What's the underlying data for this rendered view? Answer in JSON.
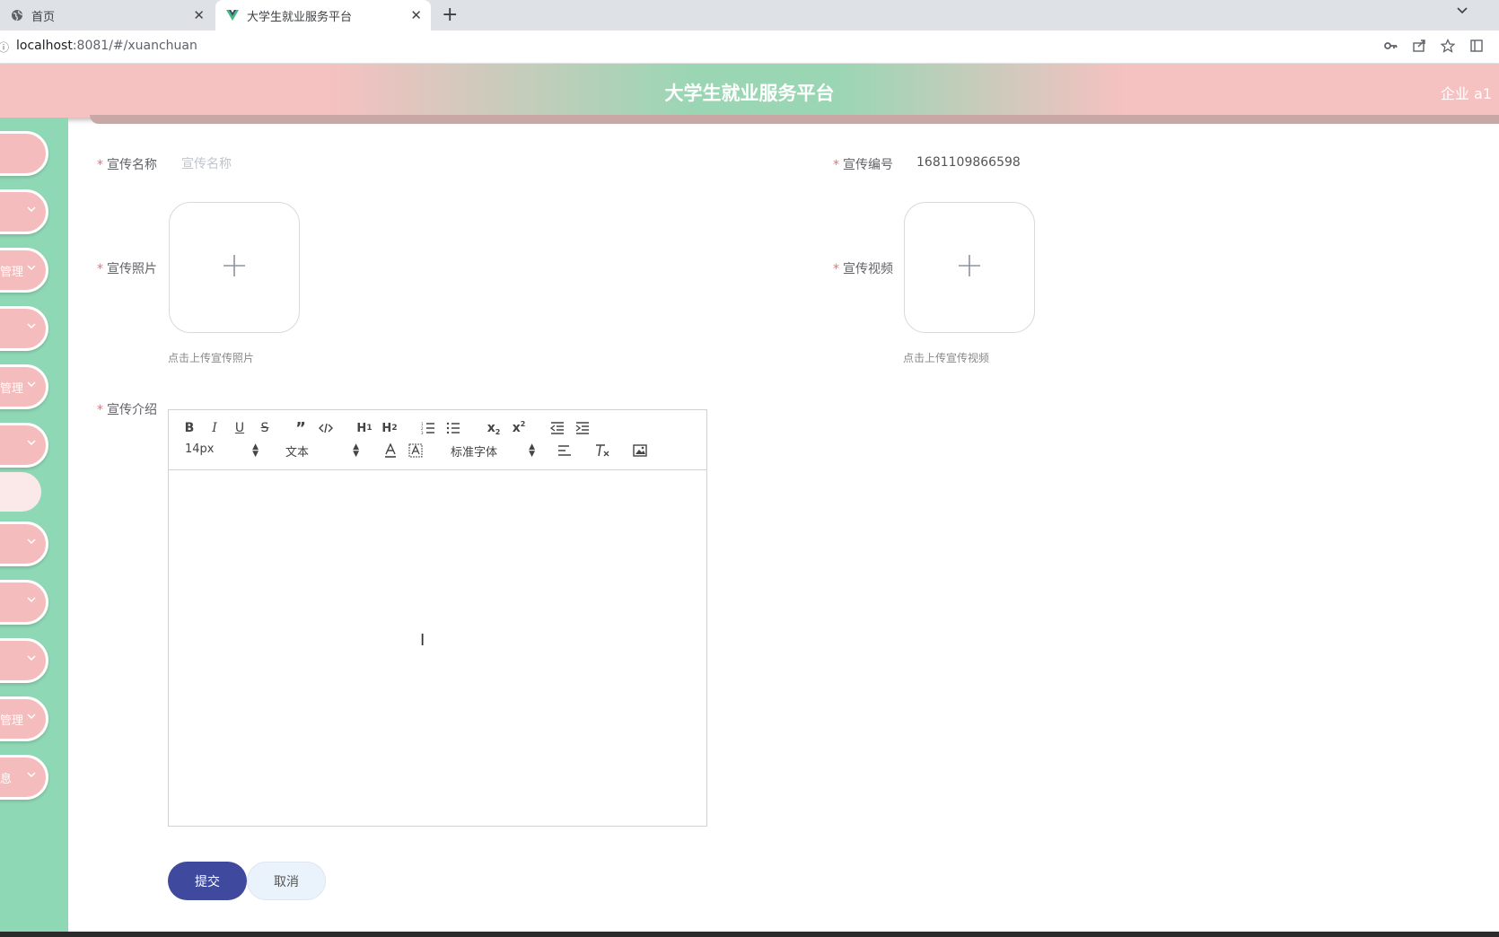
{
  "browser": {
    "tabs": [
      {
        "title": "首页",
        "active": false
      },
      {
        "title": "大学生就业服务平台",
        "active": true
      }
    ],
    "url_host": "localhost",
    "url_rest": ":8081/#/xuanchuan"
  },
  "header": {
    "title": "大学生就业服务平台",
    "user": "企业 a1"
  },
  "sidebar": {
    "items": [
      {
        "label": "",
        "has_chevron": false
      },
      {
        "label": "",
        "has_chevron": true
      },
      {
        "label": "管理",
        "has_chevron": true
      },
      {
        "label": "",
        "has_chevron": true
      },
      {
        "label": "管理",
        "has_chevron": true
      },
      {
        "label": "",
        "has_chevron": true
      },
      {
        "label": "",
        "has_chevron": true
      },
      {
        "label": "",
        "has_chevron": true
      },
      {
        "label": "",
        "has_chevron": true
      },
      {
        "label": "管理",
        "has_chevron": true
      },
      {
        "label": "息",
        "has_chevron": true
      }
    ]
  },
  "form": {
    "name": {
      "label": "宣传名称",
      "placeholder": "宣传名称",
      "value": ""
    },
    "code": {
      "label": "宣传编号",
      "value": "1681109866598"
    },
    "photo": {
      "label": "宣传照片",
      "hint": "点击上传宣传照片"
    },
    "video": {
      "label": "宣传视频",
      "hint": "点击上传宣传视频"
    },
    "intro": {
      "label": "宣传介绍"
    },
    "required_mark": "*"
  },
  "editor": {
    "size_value": "14px",
    "header_value": "文本",
    "font_value": "标准字体"
  },
  "actions": {
    "submit": "提交",
    "cancel": "取消"
  },
  "colors": {
    "header_pink": "#f5c1c1",
    "header_green": "#9bd6b4",
    "sidebar_green": "#8fd8b5",
    "menu_pink": "#f4bcbc",
    "submit_blue": "#3f4a9f",
    "required_red": "#f56c6c"
  }
}
